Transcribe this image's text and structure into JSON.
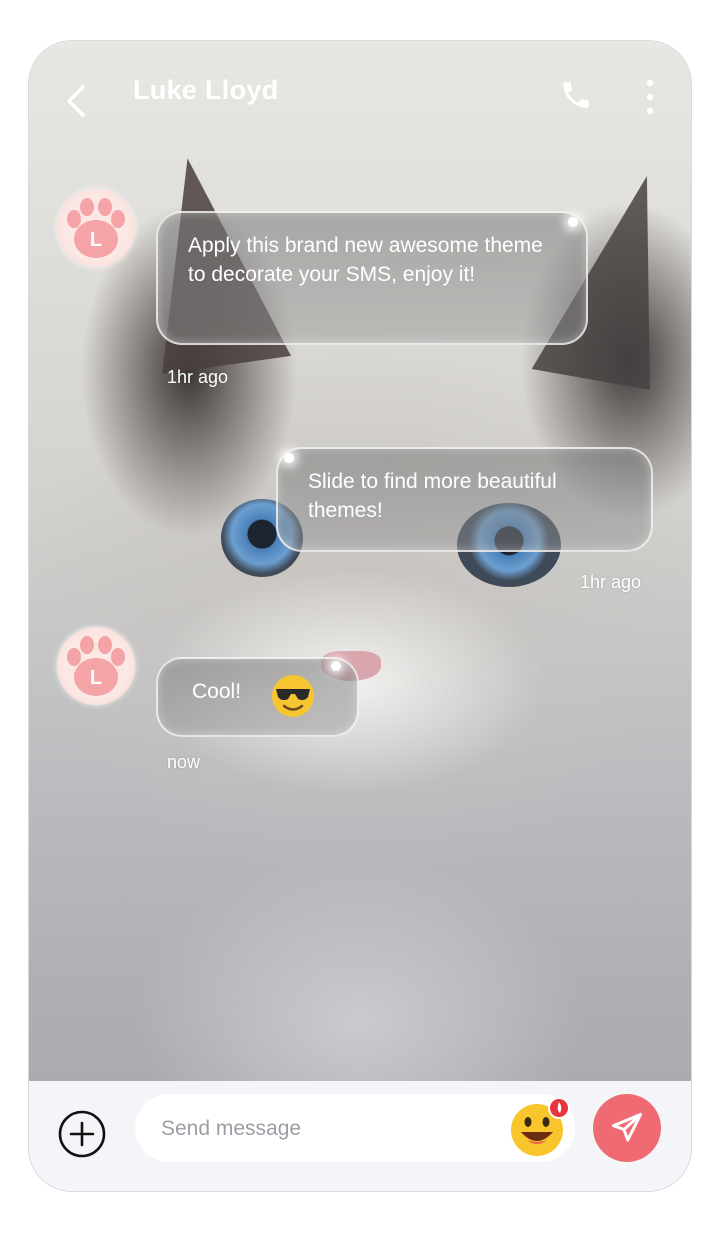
{
  "header": {
    "title": "Luke Lloyd",
    "back_icon": "chevron-left-icon",
    "call_icon": "phone-icon",
    "more_icon": "vertical-dots-icon"
  },
  "avatar_letter": "L",
  "messages": [
    {
      "text": "Apply this brand new awesome theme to decorate your SMS, enjoy it!",
      "time": "1hr ago",
      "direction": "incoming"
    },
    {
      "text": "Slide to find more beautiful themes!",
      "time": "1hr ago",
      "direction": "outgoing"
    },
    {
      "text": "Cool!",
      "emoji": "sunglasses-face",
      "time": "now",
      "direction": "incoming"
    }
  ],
  "composer": {
    "placeholder": "Send message",
    "add_icon": "plus-circle-icon",
    "emoji_icon": "laughing-emoji-icon",
    "send_icon": "paper-plane-icon"
  },
  "colors": {
    "send_button": "#ef6a72",
    "composer_bg": "#f3f5f8",
    "text_on_bubble": "#ffffff"
  }
}
